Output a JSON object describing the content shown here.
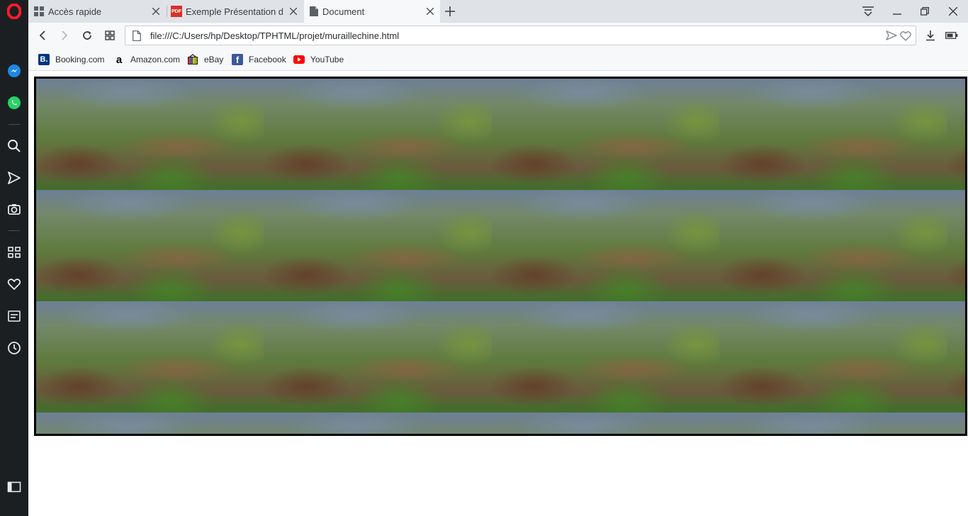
{
  "tabs": [
    {
      "title": "Accès rapide",
      "icon": "grid-icon",
      "active": false
    },
    {
      "title": "Exemple Présentation du p",
      "icon": "pdf-icon",
      "active": false
    },
    {
      "title": "Document",
      "icon": "document-icon",
      "active": true
    }
  ],
  "pdf_badge": "PDF",
  "address": {
    "url": "file:///C:/Users/hp/Desktop/TPHTML/projet/muraillechine.html"
  },
  "bookmarks": [
    {
      "label": "Booking.com",
      "icon": "booking-icon",
      "badge": "B.",
      "color": "#003580"
    },
    {
      "label": "Amazon.com",
      "icon": "amazon-icon",
      "badge": "a",
      "color": "#000000"
    },
    {
      "label": "eBay",
      "icon": "ebay-icon",
      "color": "#e53238"
    },
    {
      "label": "Facebook",
      "icon": "facebook-icon",
      "badge": "f",
      "color": "#3b5998"
    },
    {
      "label": "YouTube",
      "icon": "youtube-icon",
      "color": "#ff0000"
    }
  ],
  "sidebar": [
    "opera-logo-icon",
    "messenger-icon",
    "whatsapp-icon",
    "search-icon",
    "send-icon",
    "camera-icon",
    "speed-dial-icon",
    "heart-icon",
    "news-icon",
    "history-icon",
    "sidebar-toggle-icon"
  ],
  "page": {
    "background_image": "great-wall-of-china",
    "repeat": "tiled",
    "border_color": "#000000"
  },
  "colors": {
    "sidebar": "#1c1f21",
    "tabstrip": "#dfe2e6",
    "toolbar": "#f7f8f9",
    "opera_red": "#ff1b2d"
  }
}
